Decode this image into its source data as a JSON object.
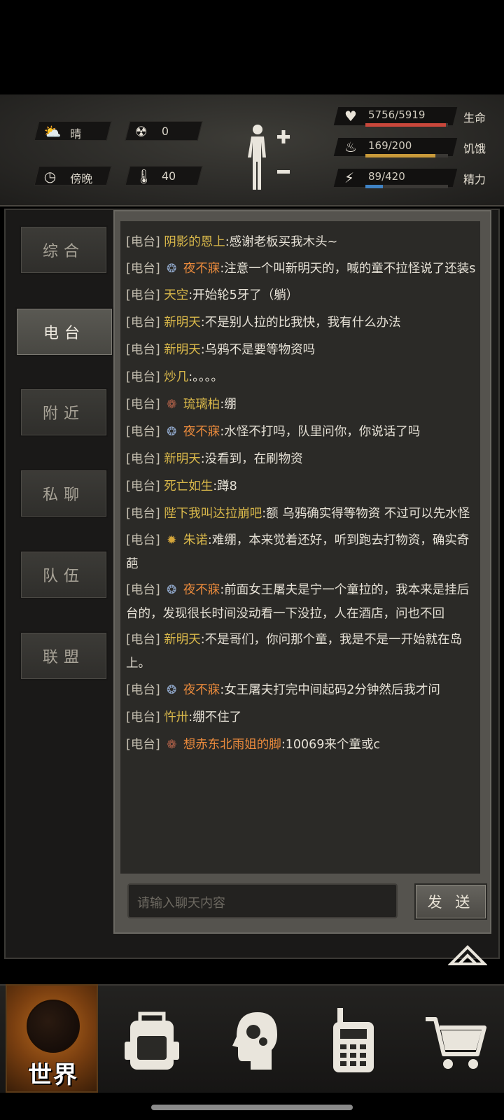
{
  "status": {
    "weather": {
      "icon": "cloudy-sun-icon",
      "label": "晴"
    },
    "radiation": {
      "icon": "radiation-icon",
      "value": "0"
    },
    "time": {
      "icon": "clock-icon",
      "label": "傍晚"
    },
    "temperature": {
      "icon": "thermometer-icon",
      "value": "40"
    }
  },
  "vitals": [
    {
      "name": "health",
      "icon": "heart-icon",
      "value": "5756/5919",
      "label": "生命",
      "fraction": 0.972,
      "color": "#c9473b"
    },
    {
      "name": "hunger",
      "icon": "stomach-icon",
      "value": "169/200",
      "label": "饥饿",
      "fraction": 0.845,
      "color": "#c99a3a"
    },
    {
      "name": "energy",
      "icon": "lightning-icon",
      "value": "89/420",
      "label": "精力",
      "fraction": 0.212,
      "color": "#3f82c4"
    }
  ],
  "tabs": [
    {
      "label": "综合",
      "active": false
    },
    {
      "label": "电台",
      "active": true
    },
    {
      "label": "附近",
      "active": false
    },
    {
      "label": "私聊",
      "active": false
    },
    {
      "label": "队伍",
      "active": false
    },
    {
      "label": "联盟",
      "active": false
    }
  ],
  "channel_tag": "[电台]",
  "messages": [
    {
      "badge": "",
      "nick": "阴影的恩上",
      "nick_color": "yellow",
      "text": ":感谢老板买我木头~"
    },
    {
      "badge": "blue-crest-icon",
      "nick": "夜不寐",
      "nick_color": "orange",
      "text": ":注意一个叫新明天的，喊的童不拉怪说了还装s"
    },
    {
      "badge": "",
      "nick": "天空",
      "nick_color": "yellow",
      "text": ":开始轮5牙了（躺）"
    },
    {
      "badge": "",
      "nick": "新明天",
      "nick_color": "yellow",
      "text": ":不是别人拉的比我快，我有什么办法"
    },
    {
      "badge": "",
      "nick": "新明天",
      "nick_color": "yellow",
      "text": ":乌鸦不是要等物资吗"
    },
    {
      "badge": "",
      "nick": "炒几",
      "nick_color": "yellow",
      "text": ":。。。。"
    },
    {
      "badge": "bronze-crest-icon",
      "nick": "琉璃柏",
      "nick_color": "yellow",
      "text": ":绷"
    },
    {
      "badge": "blue-crest-icon",
      "nick": "夜不寐",
      "nick_color": "orange",
      "text": ":水怪不打吗，队里问你，你说话了吗"
    },
    {
      "badge": "",
      "nick": "新明天",
      "nick_color": "yellow",
      "text": ":没看到，在刷物资"
    },
    {
      "badge": "",
      "nick": "死亡如生",
      "nick_color": "yellow",
      "text": ":蹲8"
    },
    {
      "badge": "",
      "nick": "陛下我叫达拉崩吧",
      "nick_color": "yellow",
      "text": ":额 乌鸦确实得等物资 不过可以先水怪"
    },
    {
      "badge": "gold-crest-icon",
      "nick": "朱诺",
      "nick_color": "yellow",
      "text": ":难绷，本来觉着还好，听到跑去打物资，确实奇葩"
    },
    {
      "badge": "blue-crest-icon",
      "nick": "夜不寐",
      "nick_color": "orange",
      "text": ":前面女王屠夫是宁一个童拉的，我本来是挂后台的，发现很长时间没动看一下没拉，人在酒店，问也不回"
    },
    {
      "badge": "",
      "nick": "新明天",
      "nick_color": "yellow",
      "text": ":不是哥们，你问那个童，我是不是一开始就在岛上。"
    },
    {
      "badge": "blue-crest-icon",
      "nick": "夜不寐",
      "nick_color": "orange",
      "text": ":女王屠夫打完中间起码2分钟然后我才问"
    },
    {
      "badge": "",
      "nick": "忤卅",
      "nick_color": "yellow",
      "text": ":绷不住了"
    },
    {
      "badge": "bronze-crest-icon",
      "nick": "想赤东北雨姐的脚",
      "nick_color": "orange",
      "text": ":10069来个童或c"
    }
  ],
  "input": {
    "placeholder": "请输入聊天内容"
  },
  "send_label": "发 送",
  "nav": {
    "world_label": "世界",
    "items": [
      "backpack-icon",
      "skills-head-icon",
      "radio-icon",
      "cart-icon"
    ]
  }
}
